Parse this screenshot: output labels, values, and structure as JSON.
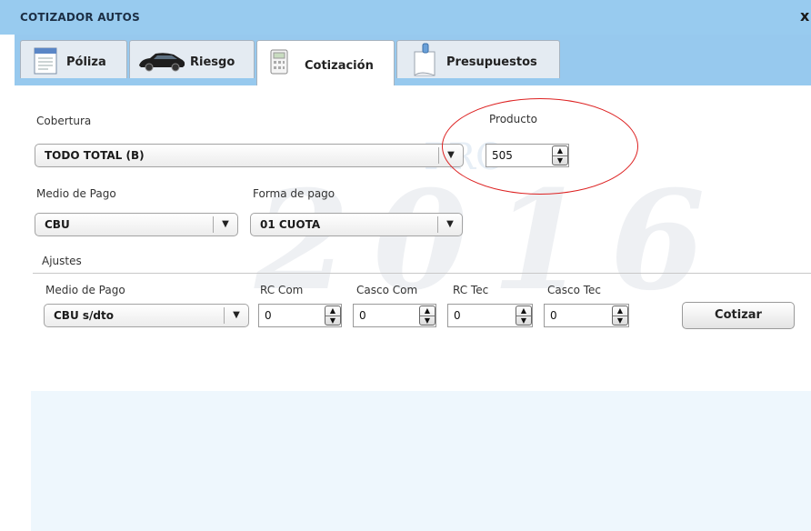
{
  "window": {
    "title": "COTIZADOR AUTOS",
    "close_label": "x"
  },
  "tabs": [
    {
      "label": "Póliza",
      "icon": "document-icon"
    },
    {
      "label": "Riesgo",
      "icon": "car-icon"
    },
    {
      "label": "Cotización",
      "icon": "calculator-icon"
    },
    {
      "label": "Presupuestos",
      "icon": "clipboard-icon"
    }
  ],
  "active_tab": "Cotización",
  "cobertura": {
    "label": "Cobertura",
    "value": "TODO TOTAL (B)"
  },
  "producto": {
    "label": "Producto",
    "value": "505"
  },
  "medio_pago": {
    "label": "Medio de Pago",
    "value": "CBU"
  },
  "forma_pago": {
    "label": "Forma de pago",
    "value": "01 CUOTA"
  },
  "ajustes": {
    "label": "Ajustes",
    "medio_pago": {
      "label": "Medio de Pago",
      "value": "CBU s/dto"
    },
    "rc_com": {
      "label": "RC Com",
      "value": "0"
    },
    "casco_com": {
      "label": "Casco Com",
      "value": "0"
    },
    "rc_tec": {
      "label": "RC Tec",
      "value": "0"
    },
    "casco_tec": {
      "label": "Casco Tec",
      "value": "0"
    },
    "cotizar_label": "Cotizar"
  },
  "watermark": {
    "text": "2016",
    "small_text": "PRO"
  },
  "colors": {
    "titlebar": "#98cbef",
    "panel": "#eef7fd",
    "annotation": "#d22222"
  }
}
